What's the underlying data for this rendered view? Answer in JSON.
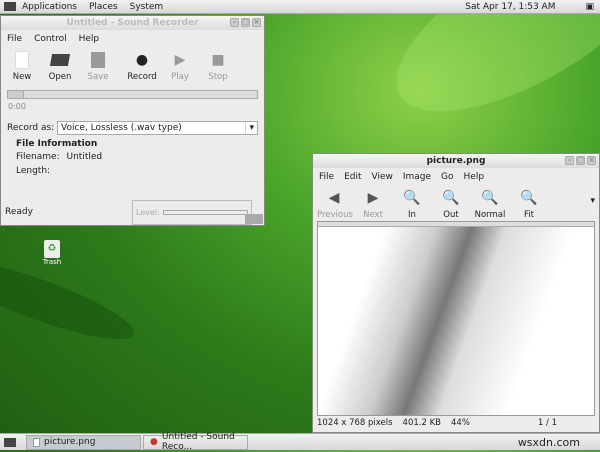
{
  "top_panel": {
    "menus": [
      "Applications",
      "Places",
      "System"
    ],
    "clock": "Sat Apr 17,  1:53 AM"
  },
  "recorder": {
    "title": "Untitled - Sound Recorder",
    "menu": [
      "File",
      "Control",
      "Help"
    ],
    "toolbar": [
      {
        "label": "New",
        "icon": "new-file-icon",
        "enabled": true
      },
      {
        "label": "Open",
        "icon": "folder-open-icon",
        "enabled": true
      },
      {
        "label": "Save",
        "icon": "save-icon",
        "enabled": false
      },
      {
        "label": "Record",
        "icon": "record-icon",
        "enabled": true
      },
      {
        "label": "Play",
        "icon": "play-icon",
        "enabled": false
      },
      {
        "label": "Stop",
        "icon": "stop-icon",
        "enabled": false
      }
    ],
    "time": "0:00",
    "record_as_label": "Record as:",
    "record_as_value": "Voice, Lossless (.wav type)",
    "file_info_heading": "File Information",
    "filename_label": "Filename:",
    "filename_value": "Untitled",
    "length_label": "Length:",
    "status": "Ready",
    "level_label": "Level:"
  },
  "desktop": {
    "trash_label": "Trash"
  },
  "viewer": {
    "title": "picture.png",
    "menu": [
      "File",
      "Edit",
      "View",
      "Image",
      "Go",
      "Help"
    ],
    "toolbar": [
      {
        "label": "Previous",
        "enabled": false
      },
      {
        "label": "Next",
        "enabled": false
      },
      {
        "label": "In",
        "enabled": true
      },
      {
        "label": "Out",
        "enabled": true
      },
      {
        "label": "Normal",
        "enabled": true
      },
      {
        "label": "Fit",
        "enabled": true
      }
    ],
    "status": {
      "dimensions": "1024 x 768 pixels",
      "size": "401.2 KB",
      "zoom": "44%",
      "page": "1 / 1"
    }
  },
  "taskbar": {
    "items": [
      "picture.png",
      "Untitled - Sound Reco..."
    ],
    "watermark": "wsxdn.com"
  }
}
